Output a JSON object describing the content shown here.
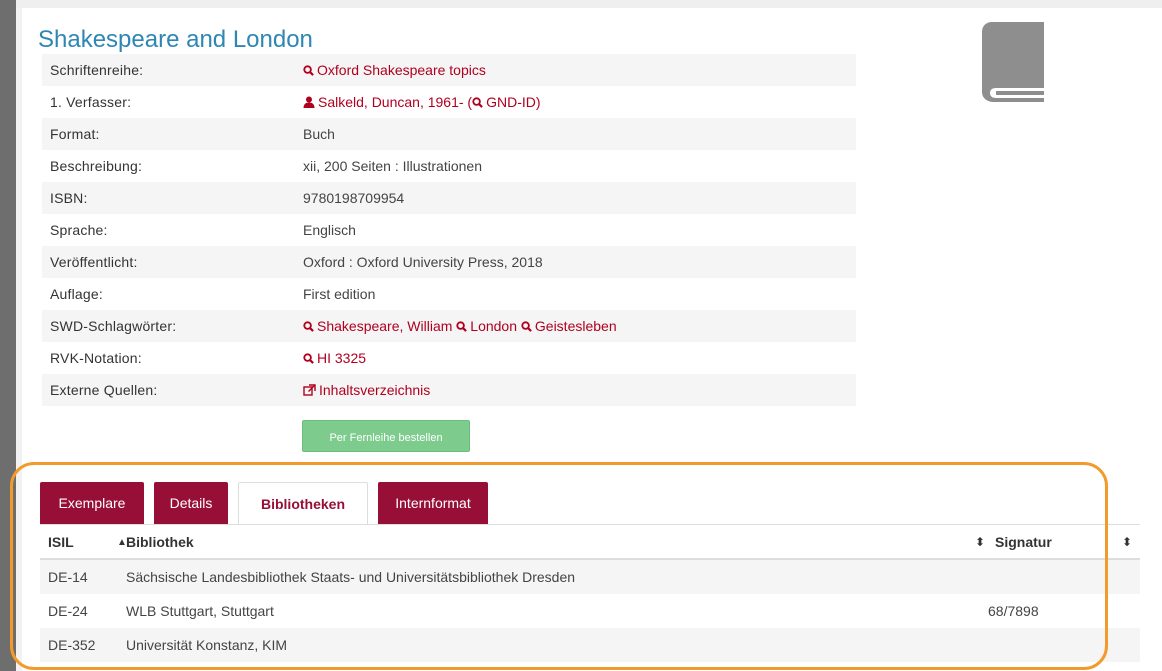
{
  "title": "Shakespeare and London",
  "details": {
    "series_label": "Schriftenreihe:",
    "series_value": "Oxford Shakespeare topics",
    "author_label": "1. Verfasser:",
    "author_value": "Salkeld, Duncan, 1961- (",
    "author_gnd": "GND-ID",
    "author_close": ")",
    "format_label": "Format:",
    "format_value": "Buch",
    "desc_label": "Beschreibung:",
    "desc_value": "xii, 200 Seiten : Illustrationen",
    "isbn_label": "ISBN:",
    "isbn_value": "9780198709954",
    "lang_label": "Sprache:",
    "lang_value": "Englisch",
    "pub_label": "Veröffentlicht:",
    "pub_value": "Oxford : Oxford University Press, 2018",
    "edition_label": "Auflage:",
    "edition_value": "First edition",
    "swd_label": "SWD-Schlagwörter:",
    "swd_values": [
      "Shakespeare, William",
      "London",
      "Geistesleben"
    ],
    "rvk_label": "RVK-Notation:",
    "rvk_value": "HI 3325",
    "ext_label": "Externe Quellen:",
    "ext_value": "Inhaltsverzeichnis"
  },
  "ill_button": "Per Fernleihe bestellen",
  "tabs": [
    {
      "label": "Exemplare",
      "active": false
    },
    {
      "label": "Details",
      "active": false
    },
    {
      "label": "Bibliotheken",
      "active": true
    },
    {
      "label": "Internformat",
      "active": false
    }
  ],
  "table": {
    "headers": {
      "isil": "ISIL",
      "bibliothek": "Bibliothek",
      "signatur": "Signatur"
    },
    "rows": [
      {
        "isil": "DE-14",
        "bibliothek": "Sächsische Landesbibliothek Staats- und Universitätsbibliothek Dresden",
        "signatur": ""
      },
      {
        "isil": "DE-24",
        "bibliothek": "WLB Stuttgart, Stuttgart",
        "signatur": "68/7898"
      },
      {
        "isil": "DE-352",
        "bibliothek": "Universität Konstanz, KIM",
        "signatur": ""
      }
    ]
  },
  "colors": {
    "accent": "#970f37",
    "link": "#b0001f",
    "title": "#2e87b3",
    "highlight": "#f39a2d",
    "button": "#7dcc8e"
  }
}
